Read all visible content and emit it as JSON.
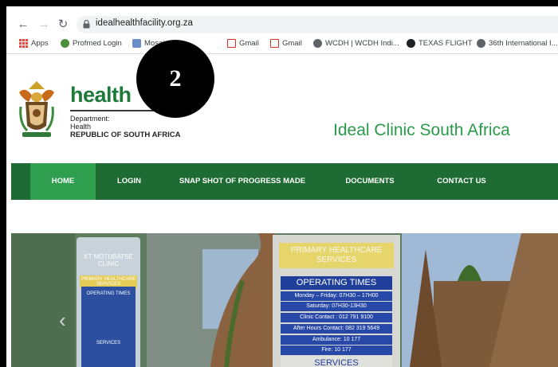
{
  "browser": {
    "url": "idealhealthfacility.org.za",
    "bookmarks": [
      {
        "label": "Apps",
        "icon": "apps-grid-icon"
      },
      {
        "label": "Profmed Login",
        "icon": "profmed-icon"
      },
      {
        "label": "Mosai...",
        "icon": "mosaic-icon"
      },
      {
        "label": "Gmail",
        "icon": "gmail-icon"
      },
      {
        "label": "Gmail",
        "icon": "gmail-icon"
      },
      {
        "label": "WCDH | WCDH Indi...",
        "icon": "globe-icon"
      },
      {
        "label": "TEXAS FLIGHT",
        "icon": "plane-icon"
      },
      {
        "label": "36th International I...",
        "icon": "globe-icon"
      }
    ]
  },
  "header": {
    "health_word": "health",
    "dept_line1": "Department:",
    "dept_line2": "Health",
    "dept_line3": "REPUBLIC OF SOUTH AFRICA",
    "site_title": "Ideal Clinic South Africa"
  },
  "nav": {
    "items": [
      {
        "label": "HOME",
        "active": true
      },
      {
        "label": "LOGIN",
        "active": false
      },
      {
        "label": "SNAP SHOT OF PROGRESS MADE",
        "active": false
      },
      {
        "label": "DOCUMENTS",
        "active": false
      },
      {
        "label": "CONTACT US",
        "active": false
      }
    ]
  },
  "hero": {
    "sign_a_title": "KT MOTUBATSE CLINIC",
    "sign_a_phc": "PRIMARY HEALTHCARE SERVICES",
    "sign_a_optimes": "OPERATING TIMES",
    "sign_a_services": "SERVICES",
    "sign_b_phc": "PRIMARY HEALTHCARE SERVICES",
    "sign_b_optimes": "OPERATING TIMES",
    "sign_b_rows": [
      "Monday – Friday: 07H30 – 17H00",
      "Saturday: 07H30-13H30",
      "Clinic Contact : 012 791 9100",
      "After Hours Contact: 082 319 5649",
      "Ambulance: 10 177",
      "Fire: 10 177"
    ],
    "sign_b_services": "SERVICES"
  },
  "annotation": {
    "number": "2"
  },
  "colors": {
    "nav_bg": "#1e6b33",
    "nav_active": "#2f9e4f",
    "title_green": "#2a9a4a"
  }
}
